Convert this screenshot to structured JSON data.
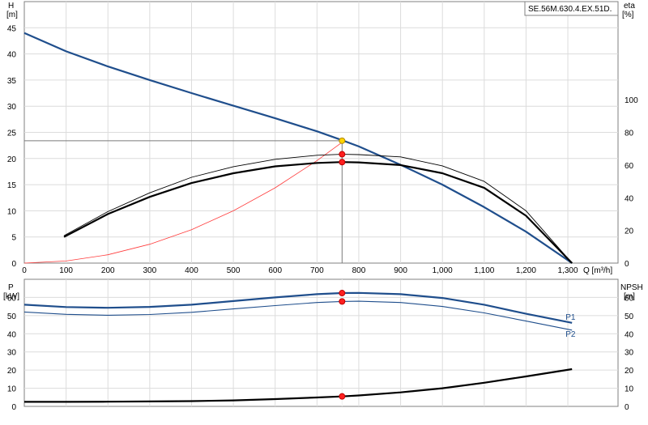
{
  "chart_data": [
    {
      "type": "line",
      "id": "head-efficiency",
      "title": "",
      "model": "SE.56M.630.4.EX.51D.",
      "xlabel": "Q [m³/h]",
      "ylabel_left": {
        "name": "H",
        "unit": "[m]"
      },
      "ylabel_right": {
        "name": "eta",
        "unit": "[%]"
      },
      "xlim": [
        0,
        1420
      ],
      "ylim_left": [
        0,
        50
      ],
      "ylim_right": [
        0,
        160
      ],
      "x_ticks": [
        {
          "v": 0,
          "label": "0"
        },
        {
          "v": 100,
          "label": "100"
        },
        {
          "v": 200,
          "label": "200"
        },
        {
          "v": 300,
          "label": "300"
        },
        {
          "v": 400,
          "label": "400"
        },
        {
          "v": 500,
          "label": "500"
        },
        {
          "v": 600,
          "label": "600"
        },
        {
          "v": 700,
          "label": "700"
        },
        {
          "v": 800,
          "label": "800"
        },
        {
          "v": 900,
          "label": "900"
        },
        {
          "v": 1000,
          "label": "1,000"
        },
        {
          "v": 1100,
          "label": "1,100"
        },
        {
          "v": 1200,
          "label": "1,200"
        },
        {
          "v": 1300,
          "label": "1,300"
        }
      ],
      "y_ticks_left": [
        0,
        5,
        10,
        15,
        20,
        25,
        30,
        35,
        40,
        45
      ],
      "y_ticks_right": [
        0,
        20,
        40,
        60,
        80,
        100
      ],
      "grid": true,
      "series": [
        {
          "id": "head",
          "color": "#1f4e8c",
          "width": 2.2,
          "x": [
            0,
            100,
            200,
            300,
            400,
            500,
            600,
            700,
            760,
            800,
            900,
            1000,
            1100,
            1200,
            1310
          ],
          "y": [
            44,
            40.5,
            37.6,
            35,
            32.5,
            30.1,
            27.7,
            25.2,
            23.5,
            22.3,
            18.8,
            15,
            10.7,
            6,
            0
          ]
        },
        {
          "id": "system",
          "color": "#ff3b3b",
          "width": 0.8,
          "x": [
            0,
            100,
            200,
            300,
            400,
            500,
            600,
            700,
            760
          ],
          "y": [
            0,
            0.4,
            1.6,
            3.6,
            6.4,
            10,
            14.4,
            19.6,
            23.1
          ]
        },
        {
          "id": "eta-total",
          "color": "#000000",
          "width": 2.2,
          "axis": "right",
          "x": [
            95,
            200,
            300,
            400,
            500,
            600,
            700,
            760,
            800,
            900,
            1000,
            1100,
            1200,
            1310
          ],
          "y": [
            16,
            30,
            40.5,
            49,
            55,
            59.2,
            61.3,
            61.8,
            61.6,
            60,
            55,
            46,
            29,
            0
          ]
        },
        {
          "id": "eta-hydraulic",
          "color": "#000000",
          "width": 0.9,
          "axis": "right",
          "x": [
            95,
            200,
            300,
            400,
            500,
            600,
            700,
            760,
            800,
            900,
            1000,
            1100,
            1200,
            1310
          ],
          "y": [
            16.8,
            31.5,
            43,
            52.5,
            59,
            63.5,
            66,
            66.6,
            66.4,
            65,
            59.5,
            50,
            32,
            0
          ]
        }
      ],
      "guides": {
        "q": 760,
        "h": 23.4,
        "color": "#7a7a7a"
      },
      "markers": [
        {
          "x": 760,
          "y": 23.4,
          "axis": "left",
          "fill": "#ffd400",
          "stroke": "#b08800"
        },
        {
          "x": 760,
          "y": 66.6,
          "axis": "right",
          "fill": "#ff2020",
          "stroke": "#c00000"
        },
        {
          "x": 760,
          "y": 61.8,
          "axis": "right",
          "fill": "#ff2020",
          "stroke": "#c00000"
        }
      ]
    },
    {
      "type": "line",
      "id": "power-npsh",
      "xlim": [
        0,
        1420
      ],
      "ylabel_left": {
        "name": "P",
        "unit": "[kW]"
      },
      "ylabel_right": {
        "name": "NPSH",
        "unit": "[m]"
      },
      "ylim_left": [
        0,
        70
      ],
      "ylim_right": [
        0,
        70
      ],
      "y_ticks_left": [
        0,
        10,
        20,
        30,
        40,
        50,
        60
      ],
      "y_ticks_right": [
        0,
        10,
        20,
        30,
        40,
        50,
        60
      ],
      "grid": true,
      "series": [
        {
          "id": "P1",
          "name": "P1",
          "color": "#1f4e8c",
          "width": 2.2,
          "x": [
            0,
            100,
            200,
            300,
            400,
            500,
            600,
            700,
            760,
            800,
            900,
            1000,
            1100,
            1200,
            1310
          ],
          "y": [
            56,
            54.7,
            54.3,
            54.8,
            56,
            58,
            60,
            61.8,
            62.4,
            62.5,
            61.8,
            59.7,
            56,
            51,
            46
          ]
        },
        {
          "id": "P2",
          "name": "P2",
          "color": "#1f4e8c",
          "width": 1.1,
          "x": [
            0,
            100,
            200,
            300,
            400,
            500,
            600,
            700,
            760,
            800,
            900,
            1000,
            1100,
            1200,
            1310
          ],
          "y": [
            52,
            50.7,
            50.2,
            50.6,
            51.8,
            53.7,
            55.5,
            57.2,
            57.8,
            57.9,
            57.2,
            55,
            51.5,
            47,
            42
          ]
        },
        {
          "id": "NPSH",
          "color": "#000000",
          "width": 2.2,
          "x": [
            0,
            100,
            200,
            300,
            400,
            500,
            600,
            700,
            760,
            800,
            900,
            1000,
            1100,
            1200,
            1310
          ],
          "y": [
            2.5,
            2.5,
            2.6,
            2.7,
            2.9,
            3.3,
            4,
            4.9,
            5.5,
            6,
            7.7,
            10,
            13,
            16.5,
            20.5
          ]
        }
      ],
      "guide_q": 760,
      "markers": [
        {
          "x": 760,
          "y": 62.4,
          "fill": "#ff2020",
          "stroke": "#c00000"
        },
        {
          "x": 760,
          "y": 57.8,
          "fill": "#ff2020",
          "stroke": "#c00000"
        },
        {
          "x": 760,
          "y": 5.5,
          "fill": "#ff2020",
          "stroke": "#c00000"
        }
      ]
    }
  ]
}
